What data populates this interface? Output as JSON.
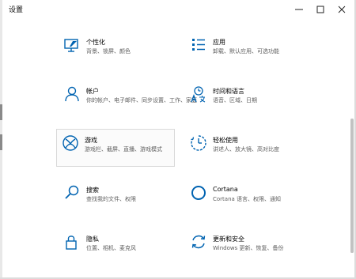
{
  "window": {
    "title": "设置"
  },
  "controls": {
    "minimize_icon": "minimize-icon",
    "maximize_icon": "maximize-icon",
    "close_icon": "close-icon"
  },
  "accent_color": "#0063b1",
  "tiles": [
    {
      "label": "个性化",
      "description": "背景、锁屏、颜色",
      "icon": "personalization-icon"
    },
    {
      "label": "应用",
      "description": "卸载、默认应用、可选功能",
      "icon": "apps-icon"
    },
    {
      "label": "帐户",
      "description": "你的帐户、电子邮件、同步设置、工作、家庭",
      "icon": "account-icon"
    },
    {
      "label": "时间和语言",
      "description": "语音、区域、日期",
      "icon": "time-language-icon"
    },
    {
      "label": "游戏",
      "description": "游戏栏、截屏、直播、游戏模式",
      "icon": "xbox-icon"
    },
    {
      "label": "轻松使用",
      "description": "讲述人、放大镜、高对比度",
      "icon": "ease-of-access-icon"
    },
    {
      "label": "搜索",
      "description": "查找我的文件、权限",
      "icon": "search-icon"
    },
    {
      "label": "Cortana",
      "description": "Cortana 语言、权限、通知",
      "icon": "cortana-icon"
    },
    {
      "label": "隐私",
      "description": "位置、相机、麦克风",
      "icon": "privacy-lock-icon"
    },
    {
      "label": "更新和安全",
      "description": "Windows 更新、恢复、备份",
      "icon": "update-security-icon"
    }
  ]
}
